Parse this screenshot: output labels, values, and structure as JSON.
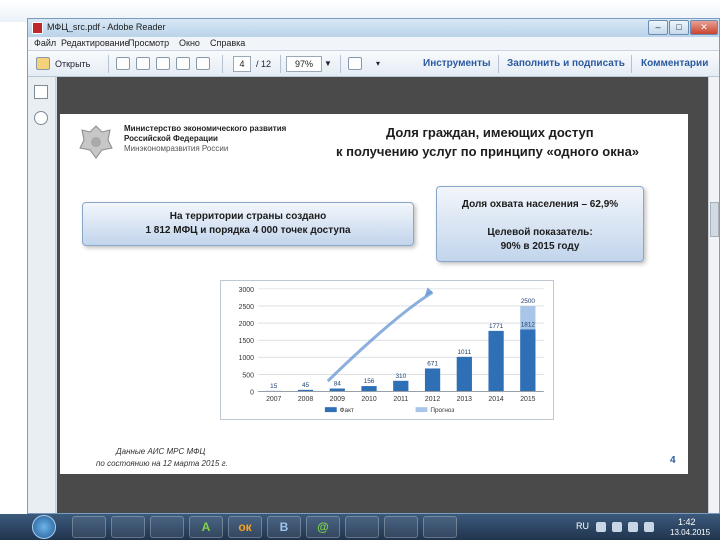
{
  "window": {
    "title": "МФЦ_src.pdf - Adobe Reader",
    "controls": {
      "minimize": "–",
      "maximize": "□",
      "close": "✕"
    }
  },
  "menu": [
    "Файл",
    "Редактирование",
    "Просмотр",
    "Окно",
    "Справка"
  ],
  "toolbar": {
    "open_label": "Открыть",
    "page_current": "4",
    "page_total": "/ 12",
    "zoom": "97%",
    "tools_label": "Инструменты",
    "fill_sign_label": "Заполнить и подписать",
    "comments_label": "Комментарии"
  },
  "slide": {
    "ministry_lines": [
      "Министерство экономического развития",
      "Российской Федерации",
      "Минэкономразвития России"
    ],
    "title_lines": [
      "Доля граждан, имеющих доступ",
      "к получению услуг по принципу «одного окна»"
    ],
    "left_box_lines": [
      "На территории страны создано",
      "1 812 МФЦ и порядка 4 000 точек доступа"
    ],
    "right_box_lines": [
      "Доля охвата населения – 62,9%",
      "Целевой показатель:",
      "90% в 2015 году"
    ],
    "footnote_lines": [
      "Данные АИС МРС МФЦ",
      "по состоянию на 12 марта 2015 г."
    ],
    "page_number": "4"
  },
  "chart_data": {
    "type": "bar",
    "categories": [
      "2007",
      "2008",
      "2009",
      "2010",
      "2011",
      "2012",
      "2013",
      "2014",
      "2015"
    ],
    "series": [
      {
        "name": "Факт",
        "values": [
          15,
          45,
          84,
          156,
          310,
          671,
          1011,
          1771,
          1812
        ]
      },
      {
        "name": "Прогноз",
        "values": [
          null,
          null,
          null,
          null,
          null,
          null,
          null,
          null,
          2500
        ]
      }
    ],
    "ylim": [
      0,
      3000
    ],
    "yticks": [
      0,
      500,
      1000,
      1500,
      2000,
      2500,
      3000
    ],
    "value_labels": [
      "15",
      "45",
      "84",
      "156",
      "310",
      "671",
      "1011",
      "1771",
      "1812",
      "2500"
    ],
    "grid": true,
    "legend_position": "bottom-left",
    "colors": {
      "fact": "#2e6fb5",
      "forecast": "#a9c6e8"
    }
  },
  "taskbar": {
    "apps": [
      "",
      "",
      "",
      "",
      "A",
      "ок",
      "В",
      "@",
      "",
      "",
      ""
    ],
    "lang": "RU",
    "time": "1:42",
    "date": "13.04.2015"
  }
}
